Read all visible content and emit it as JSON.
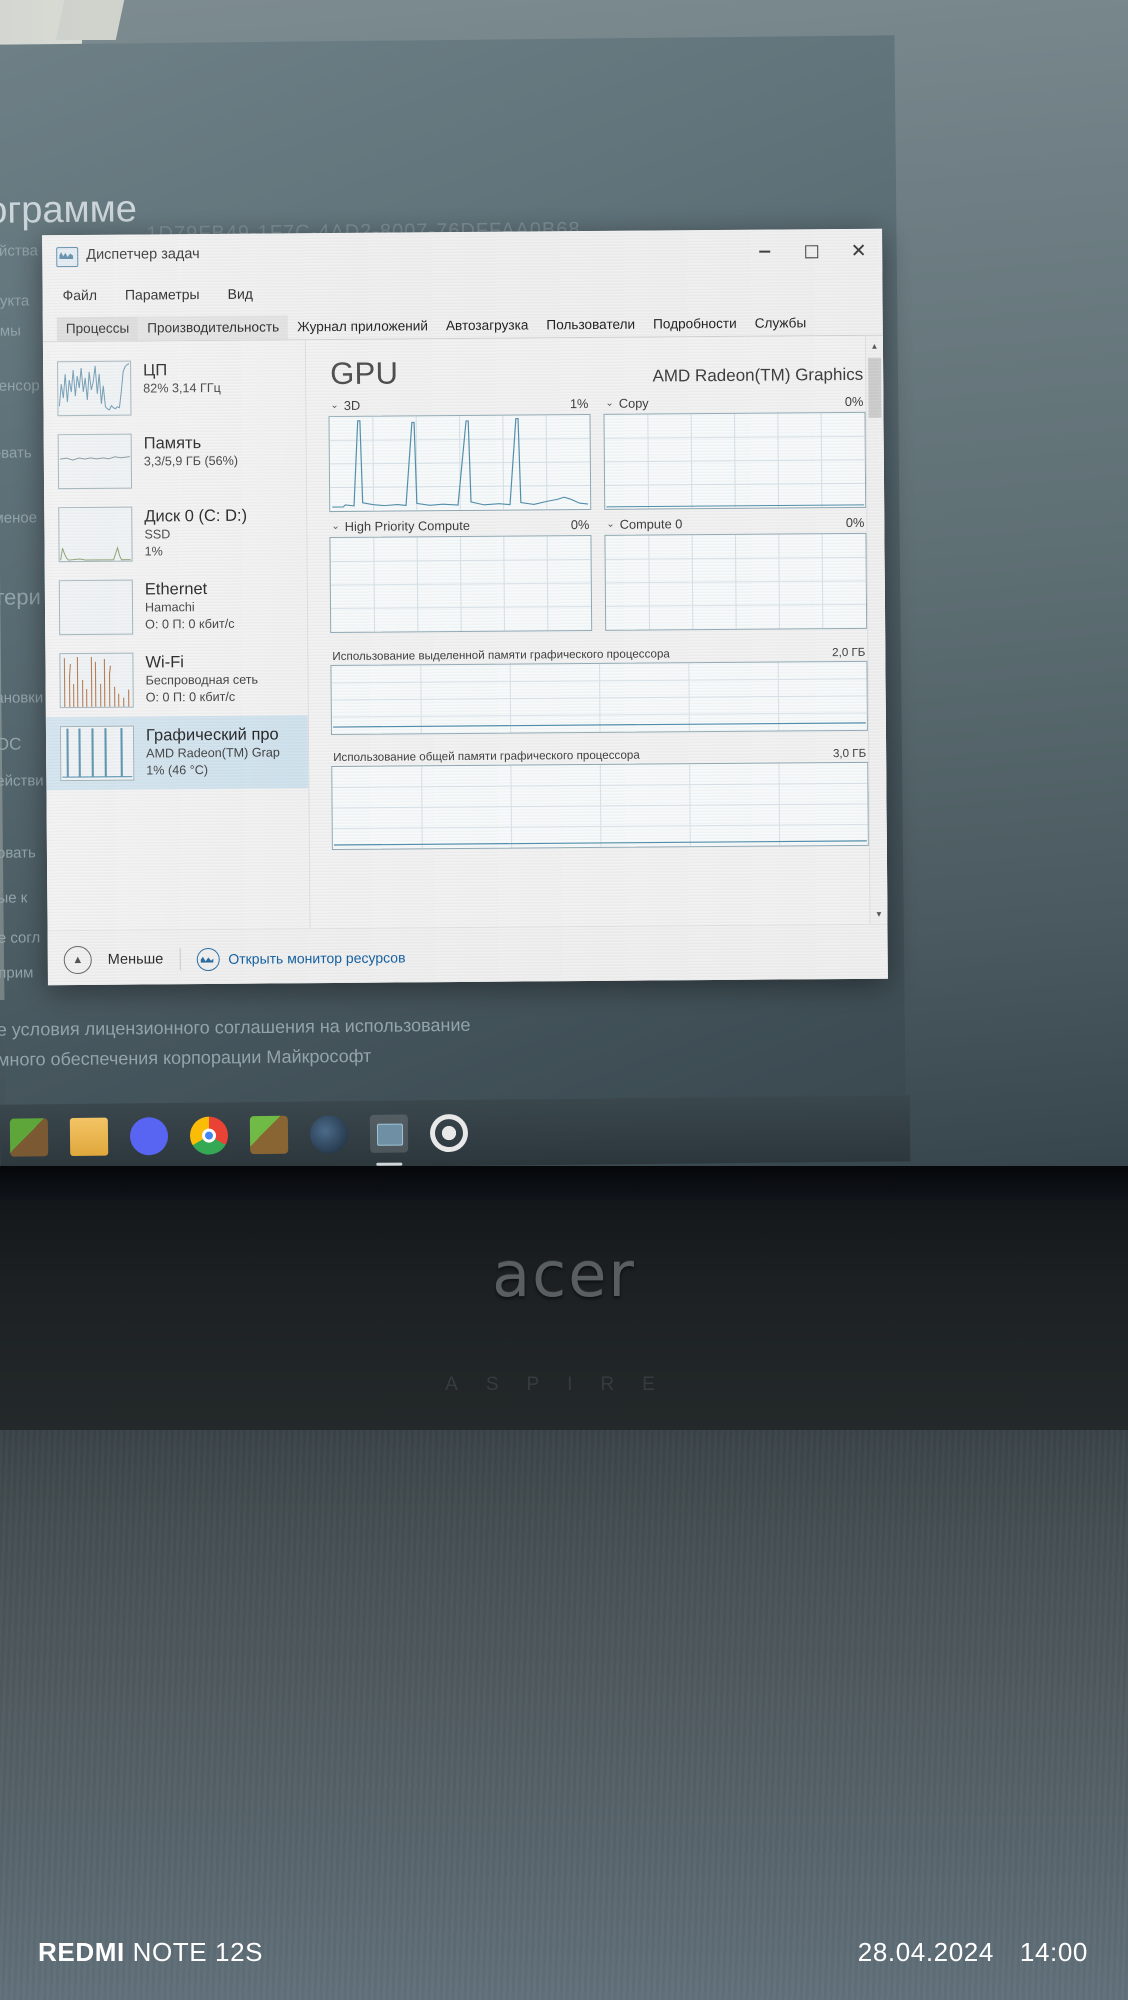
{
  "background": {
    "heading": "ограмме",
    "guid": "1D79FB49-1F7C-4AD2-8007-76DFFAA0B68",
    "left_labels": [
      "ойства",
      "дукта",
      "емы",
      "тенсор",
      "овать",
      "меное",
      "тери",
      "ановки",
      "ОС",
      "ействи",
      "овать",
      "ые к",
      "е согл",
      "прим"
    ],
    "license_line1": "е условия лицензионного соглашения на использование",
    "license_line2": "много обеспечения корпорации Майкрософт"
  },
  "window": {
    "title": "Диспетчер задач",
    "icon": "task-manager-icon",
    "controls": {
      "minimize": "—",
      "maximize": "□",
      "close": "✕"
    },
    "menu": [
      "Файл",
      "Параметры",
      "Вид"
    ],
    "tabs": [
      {
        "label": "Процессы",
        "active": false
      },
      {
        "label": "Производительность",
        "active": true
      },
      {
        "label": "Журнал приложений",
        "active": false
      },
      {
        "label": "Автозагрузка",
        "active": false
      },
      {
        "label": "Пользователи",
        "active": false
      },
      {
        "label": "Подробности",
        "active": false
      },
      {
        "label": "Службы",
        "active": false
      }
    ]
  },
  "sidebar": {
    "items": [
      {
        "name": "ЦП",
        "sub1": "82% 3,14 ГГц",
        "sub2": "",
        "selected": false,
        "color": "#6d9ab5",
        "spark": "cpu"
      },
      {
        "name": "Память",
        "sub1": "3,3/5,9 ГБ (56%)",
        "sub2": "",
        "selected": false,
        "color": "#7d8fa0",
        "spark": "mem"
      },
      {
        "name": "Диск 0 (C: D:)",
        "sub1": "SSD",
        "sub2": "1%",
        "selected": false,
        "color": "#7f9b63",
        "spark": "disk"
      },
      {
        "name": "Ethernet",
        "sub1": "Hamachi",
        "sub2": "О: 0 П: 0 кбит/с",
        "selected": false,
        "color": "#9aa7ad",
        "spark": "flat"
      },
      {
        "name": "Wi-Fi",
        "sub1": "Беспроводная сеть",
        "sub2": "О: 0 П: 0 кбит/с",
        "selected": false,
        "color": "#b5713f",
        "spark": "wifi"
      },
      {
        "name": "Графический про",
        "sub1": "AMD Radeon(TM) Grap",
        "sub2": "1%  (46 °C)",
        "selected": true,
        "color": "#4b8fae",
        "spark": "gpu"
      }
    ]
  },
  "detail": {
    "title": "GPU",
    "model": "AMD Radeon(TM) Graphics",
    "engines": [
      {
        "label": "3D",
        "value": "1%"
      },
      {
        "label": "Copy",
        "value": "0%"
      },
      {
        "label": "High Priority Compute",
        "value": "0%"
      },
      {
        "label": "Compute 0",
        "value": "0%"
      }
    ],
    "memory": [
      {
        "label": "Использование выделенной памяти графического процессора",
        "value": "2,0 ГБ"
      },
      {
        "label": "Использование общей памяти графического процессора",
        "value": "3,0 ГБ"
      }
    ]
  },
  "footer": {
    "less_label": "Меньше",
    "less_icon": "chevron-up-circle-icon",
    "resource_monitor_label": "Открыть монитор ресурсов",
    "resource_monitor_icon": "resource-monitor-icon"
  },
  "taskbar": {
    "items": [
      {
        "name": "minecraft-icon",
        "active": false
      },
      {
        "name": "file-explorer-icon",
        "active": false
      },
      {
        "name": "discord-icon",
        "active": false
      },
      {
        "name": "chrome-icon",
        "active": false
      },
      {
        "name": "minecraft-launcher-icon",
        "active": false
      },
      {
        "name": "steam-icon",
        "active": false
      },
      {
        "name": "task-manager-icon",
        "active": true
      },
      {
        "name": "settings-gear-icon",
        "active": false
      }
    ]
  },
  "laptop": {
    "brand": "acer",
    "series": "ASPIRE"
  },
  "watermark": {
    "device_brand": "REDMI",
    "device_model": "NOTE 12S",
    "date": "28.04.2024",
    "time": "14:00"
  },
  "colors": {
    "accent": "#0b5fa6",
    "selected_row": "#cfe3ef",
    "graph_line": "#4b8fae",
    "graph_border": "#8fa9b5"
  }
}
